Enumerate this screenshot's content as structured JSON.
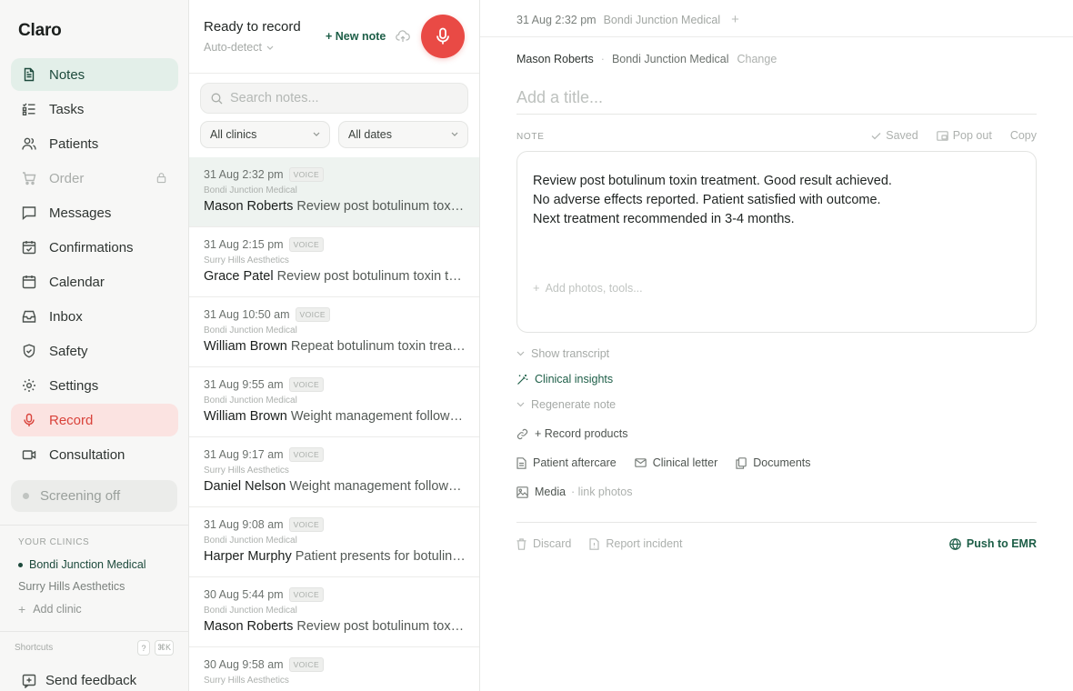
{
  "app": {
    "name": "Claro"
  },
  "sidebar": {
    "items": [
      {
        "label": "Notes",
        "icon": "notes-icon",
        "state": "active"
      },
      {
        "label": "Tasks",
        "icon": "tasks-icon"
      },
      {
        "label": "Patients",
        "icon": "patients-icon"
      },
      {
        "label": "Order",
        "icon": "cart-icon",
        "state": "disabled",
        "locked": true
      },
      {
        "label": "Messages",
        "icon": "message-icon"
      },
      {
        "label": "Confirmations",
        "icon": "calendar-check-icon"
      },
      {
        "label": "Calendar",
        "icon": "calendar-icon"
      },
      {
        "label": "Inbox",
        "icon": "inbox-icon"
      },
      {
        "label": "Safety",
        "icon": "shield-icon"
      },
      {
        "label": "Settings",
        "icon": "gear-icon"
      },
      {
        "label": "Record",
        "icon": "mic-icon",
        "state": "record"
      },
      {
        "label": "Consultation",
        "icon": "video-icon"
      }
    ],
    "screening": "Screening off",
    "clinics_label": "YOUR CLINICS",
    "clinics": [
      {
        "name": "Bondi Junction Medical",
        "active": true
      },
      {
        "name": "Surry Hills Aesthetics",
        "active": false
      }
    ],
    "add_clinic": "Add clinic",
    "shortcuts_label": "Shortcuts",
    "shortcut_keys": [
      "?",
      "⌘K"
    ],
    "feedback": "Send feedback"
  },
  "recorder": {
    "title": "Ready to record",
    "mode": "Auto-detect",
    "new_note": "+ New note"
  },
  "search": {
    "placeholder": "Search notes..."
  },
  "filters": {
    "clinic": "All clinics",
    "dates": "All dates"
  },
  "notes": [
    {
      "time": "31 Aug 2:32 pm",
      "badge": "VOICE",
      "clinic": "Bondi Junction Medical",
      "patient": "Mason Roberts",
      "summary": "Review post botulinum toxin treatment. Good result achieved.",
      "selected": true
    },
    {
      "time": "31 Aug 2:15 pm",
      "badge": "VOICE",
      "clinic": "Surry Hills Aesthetics",
      "patient": "Grace Patel",
      "summary": "Review post botulinum toxin treatment."
    },
    {
      "time": "31 Aug 10:50 am",
      "badge": "VOICE",
      "clinic": "Bondi Junction Medical",
      "patient": "William Brown",
      "summary": "Repeat botulinum toxin treatment."
    },
    {
      "time": "31 Aug 9:55 am",
      "badge": "VOICE",
      "clinic": "Bondi Junction Medical",
      "patient": "William Brown",
      "summary": "Weight management follow-up."
    },
    {
      "time": "31 Aug 9:17 am",
      "badge": "VOICE",
      "clinic": "Surry Hills Aesthetics",
      "patient": "Daniel Nelson",
      "summary": "Weight management follow-up."
    },
    {
      "time": "31 Aug 9:08 am",
      "badge": "VOICE",
      "clinic": "Bondi Junction Medical",
      "patient": "Harper Murphy",
      "summary": "Patient presents for botulinum toxin treatment."
    },
    {
      "time": "30 Aug 5:44 pm",
      "badge": "VOICE",
      "clinic": "Bondi Junction Medical",
      "patient": "Mason Roberts",
      "summary": "Review post botulinum toxin treatment."
    },
    {
      "time": "30 Aug 9:58 am",
      "badge": "VOICE",
      "clinic": "Surry Hills Aesthetics",
      "patient": "",
      "summary": ""
    }
  ],
  "detail": {
    "datetime": "31 Aug 2:32 pm",
    "clinic": "Bondi Junction Medical",
    "patient": "Mason Roberts",
    "change": "Change",
    "title_placeholder": "Add a title...",
    "note_label": "NOTE",
    "actions": {
      "saved": "Saved",
      "popout": "Pop out",
      "copy": "Copy"
    },
    "note_lines": [
      "Review post botulinum toxin treatment. Good result achieved.",
      "No adverse effects reported. Patient satisfied with outcome.",
      "Next treatment recommended in 3-4 months."
    ],
    "add_photos": "Add photos, tools...",
    "show_transcript": "Show transcript",
    "clinical_insights": "Clinical insights",
    "regenerate": "Regenerate note",
    "record_products": "+ Record products",
    "tools": {
      "aftercare": "Patient aftercare",
      "letter": "Clinical letter",
      "documents": "Documents"
    },
    "media": "Media",
    "media_sub": "· link photos",
    "discard": "Discard",
    "report": "Report incident",
    "push": "Push to EMR"
  },
  "colors": {
    "accent": "#1d5e47",
    "active_bg": "#e3efe9",
    "record": "#e94a45",
    "record_bg": "#fbe3e1"
  }
}
